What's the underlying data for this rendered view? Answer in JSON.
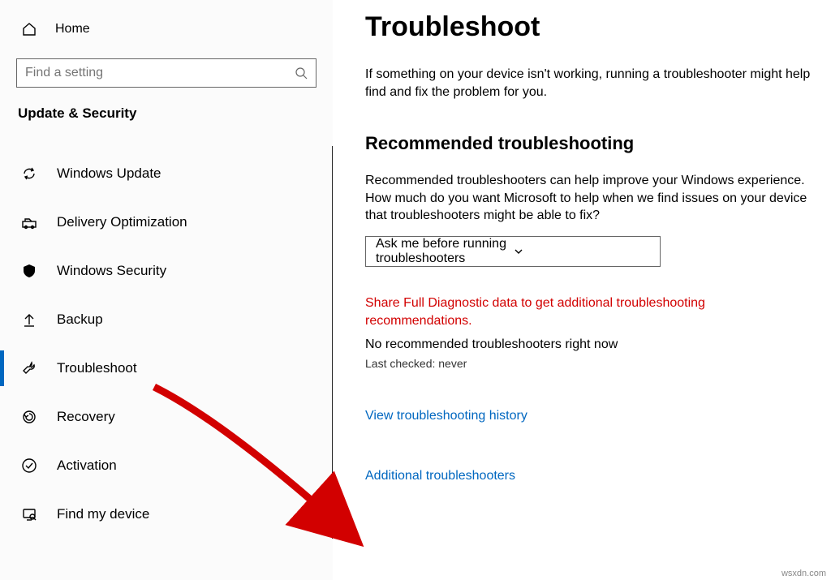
{
  "sidebar": {
    "home": "Home",
    "search_placeholder": "Find a setting",
    "section": "Update & Security",
    "items": [
      {
        "label": "Windows Update",
        "icon": "refresh-icon"
      },
      {
        "label": "Delivery Optimization",
        "icon": "delivery-icon"
      },
      {
        "label": "Windows Security",
        "icon": "shield-icon"
      },
      {
        "label": "Backup",
        "icon": "backup-icon"
      },
      {
        "label": "Troubleshoot",
        "icon": "wrench-icon"
      },
      {
        "label": "Recovery",
        "icon": "recovery-icon"
      },
      {
        "label": "Activation",
        "icon": "activation-icon"
      },
      {
        "label": "Find my device",
        "icon": "findmydevice-icon"
      }
    ]
  },
  "main": {
    "title": "Troubleshoot",
    "intro": "If something on your device isn't working, running a troubleshooter might help find and fix the problem for you.",
    "section_heading": "Recommended troubleshooting",
    "rec_text": "Recommended troubleshooters can help improve your Windows experience. How much do you want Microsoft to help when we find issues on your device that troubleshooters might be able to fix?",
    "dropdown_value": "Ask me before running troubleshooters",
    "warning": "Share Full Diagnostic data to get additional troubleshooting recommendations.",
    "no_rec": "No recommended troubleshooters right now",
    "last_checked": "Last checked: never",
    "history_link": "View troubleshooting history",
    "additional_link": "Additional troubleshooters"
  },
  "watermark": "wsxdn.com"
}
